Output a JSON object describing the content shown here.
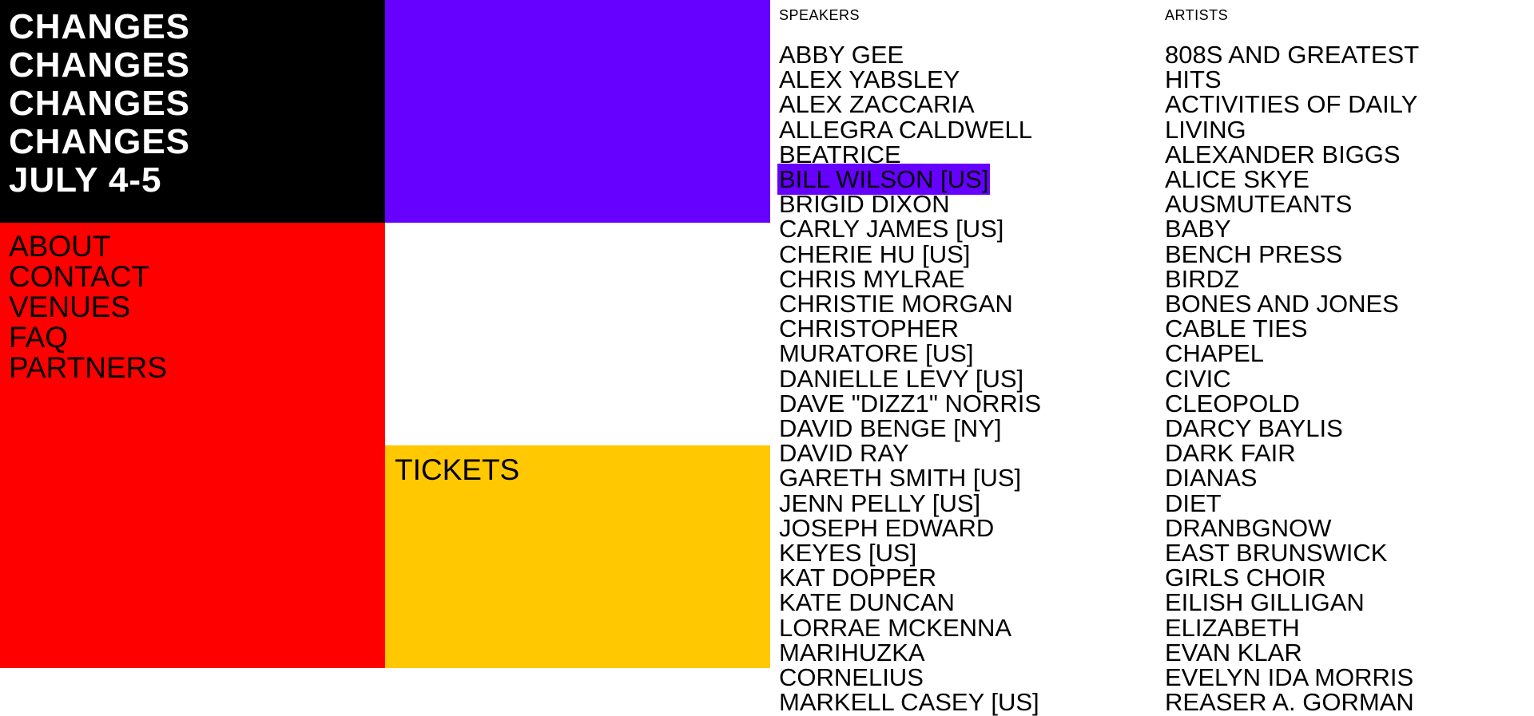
{
  "logo": {
    "lines": [
      "CHANGES",
      "CHANGES",
      "CHANGES",
      "CHANGES",
      "JULY 4-5"
    ]
  },
  "nav": {
    "items": [
      "ABOUT",
      "CONTACT",
      "VENUES",
      "FAQ",
      "PARTNERS"
    ]
  },
  "tickets": {
    "label": "TICKETS"
  },
  "speakers": {
    "heading": "SPEAKERS",
    "highlighted": "BILL WILSON [US]",
    "items": [
      "ABBY GEE",
      "ALEX YABSLEY",
      "ALEX ZACCARIA",
      "ALLEGRA CALDWELL",
      "BEATRICE",
      "BILL WILSON [US]",
      "BRIGID DIXON",
      "CARLY JAMES [US]",
      "CHERIE HU [US]",
      "CHRIS MYLRAE",
      "CHRISTIE MORGAN",
      "CHRISTOPHER",
      "MURATORE [US]",
      "DANIELLE LEVY [US]",
      "DAVE \"DIZZ1\" NORRIS",
      "DAVID BENGE [NY]",
      "DAVID RAY",
      "GARETH SMITH [US]",
      "JENN PELLY [US]",
      "JOSEPH EDWARD",
      "KEYES [US]",
      "KAT DOPPER",
      "KATE DUNCAN",
      "LORRAE MCKENNA",
      "MARIHUZKA",
      "CORNELIUS",
      "MARKELL CASEY [US]"
    ]
  },
  "artists": {
    "heading": "ARTISTS",
    "items": [
      "808S AND GREATEST",
      "HITS",
      "ACTIVITIES OF DAILY",
      "LIVING",
      "ALEXANDER BIGGS",
      "ALICE SKYE",
      "AUSMUTEANTS",
      "BABY",
      "BENCH PRESS",
      "BIRDZ",
      "BONES AND JONES",
      "CABLE TIES",
      "CHAPEL",
      "CIVIC",
      "CLEOPOLD",
      "DARCY BAYLIS",
      "DARK FAIR",
      "DIANAS",
      "DIET",
      "DRANBGNOW",
      "EAST BRUNSWICK",
      "GIRLS CHOIR",
      "EILISH GILLIGAN",
      "ELIZABETH",
      "EVAN KLAR",
      "EVELYN IDA MORRIS",
      "REASER A. GORMAN"
    ]
  },
  "colors": {
    "logo_bg": "#000000",
    "purple": "#6600ff",
    "red": "#ff0000",
    "yellow": "#ffc800",
    "text": "#000000"
  }
}
